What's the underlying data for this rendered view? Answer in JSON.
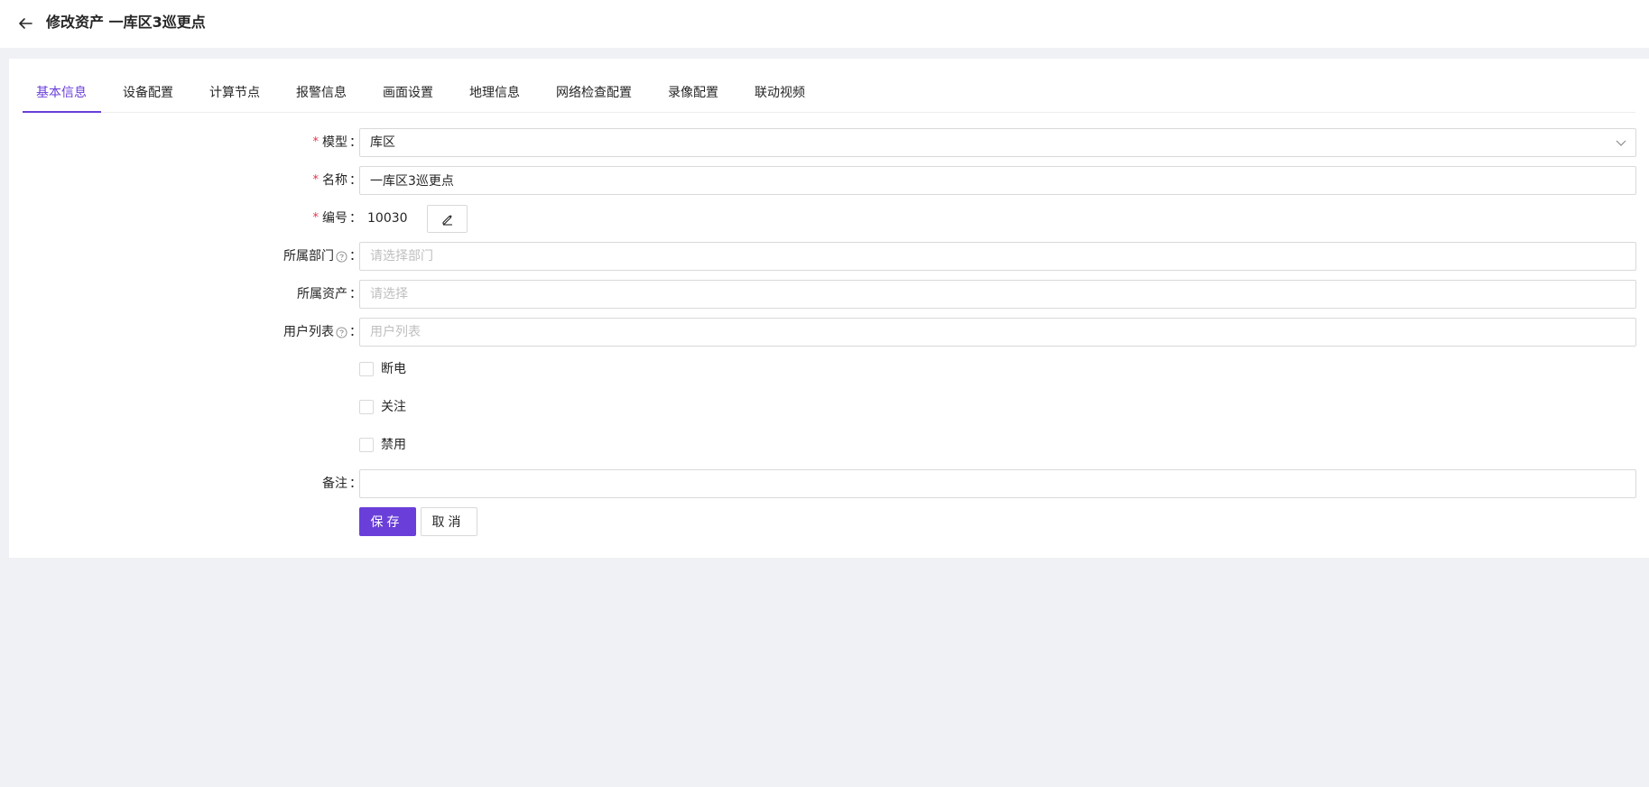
{
  "header": {
    "title": "修改资产 一库区3巡更点"
  },
  "tabs": [
    {
      "label": "基本信息",
      "active": true
    },
    {
      "label": "设备配置"
    },
    {
      "label": "计算节点"
    },
    {
      "label": "报警信息"
    },
    {
      "label": "画面设置"
    },
    {
      "label": "地理信息"
    },
    {
      "label": "网络检查配置"
    },
    {
      "label": "录像配置"
    },
    {
      "label": "联动视频"
    }
  ],
  "form": {
    "model": {
      "label": "模型",
      "required": true,
      "value": "库区"
    },
    "name": {
      "label": "名称",
      "required": true,
      "value": "一库区3巡更点"
    },
    "code": {
      "label": "编号",
      "required": true,
      "value": "10030"
    },
    "department": {
      "label": "所属部门",
      "placeholder": "请选择部门"
    },
    "asset": {
      "label": "所属资产",
      "placeholder": "请选择"
    },
    "users": {
      "label": "用户列表",
      "placeholder": "用户列表"
    },
    "checkboxes": [
      {
        "label": "断电",
        "checked": false
      },
      {
        "label": "关注",
        "checked": false
      },
      {
        "label": "禁用",
        "checked": false
      }
    ],
    "remark": {
      "label": "备注",
      "value": ""
    },
    "colon": "："
  },
  "actions": {
    "save_label": "保存",
    "cancel_label": "取消"
  },
  "colors": {
    "accent": "#6a3fd9",
    "required": "#e8334a",
    "background": "#f0f1f5"
  }
}
